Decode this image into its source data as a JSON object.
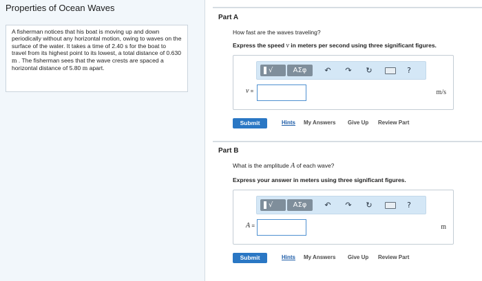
{
  "problem": {
    "title": "Properties of Ocean Waves",
    "text_before_1": "A fisherman notices that his boat is moving up and down periodically without any horizontal motion, owing to waves on the surface of the water. It takes a time of 2.40 s for the boat to travel from its highest point to its lowest, a total distance of 0.630 ",
    "unit_1": "m",
    "text_before_2": " . The fisherman sees that the wave crests are spaced a horizontal distance of 5.80 ",
    "unit_2": "m",
    "text_after": " apart."
  },
  "toolbar": {
    "templates_glyph": "√",
    "greek_label": "ΑΣφ",
    "undo_icon": "↶",
    "redo_icon": "↷",
    "reset_icon": "↻",
    "help_label": "?"
  },
  "parts": [
    {
      "label": "Part A",
      "question": "How fast are the waves traveling?",
      "instruction_before": "Express the speed ",
      "instruction_var": "v",
      "instruction_after": " in meters per second using three significant figures.",
      "var_label": "v",
      "eq": " =",
      "unit": "m/s",
      "input_value": "",
      "submit": "Submit",
      "hints": "Hints",
      "my_answers": "My Answers",
      "give_up": "Give Up",
      "review_part": "Review Part"
    },
    {
      "label": "Part B",
      "question_before": "What is the amplitude ",
      "question_var": "A",
      "question_after": " of each wave?",
      "instruction": "Express your answer in meters using three significant figures.",
      "var_label": "A",
      "eq": " =",
      "unit": "m",
      "input_value": "",
      "submit": "Submit",
      "hints": "Hints",
      "my_answers": "My Answers",
      "give_up": "Give Up",
      "review_part": "Review Part"
    }
  ]
}
